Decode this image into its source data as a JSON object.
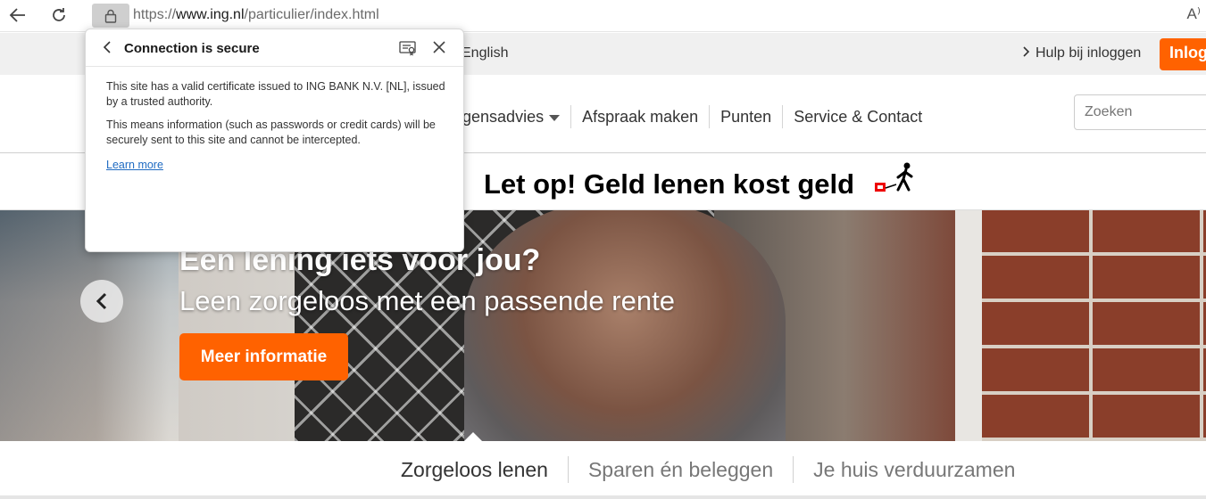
{
  "browser": {
    "url_prefix": "https://",
    "url_domain": "www.ing.nl",
    "url_path": "/particulier/index.html",
    "read_aloud": "A⁾"
  },
  "topbar": {
    "language": "English",
    "help": "Hulp bij inloggen",
    "login": "Inlog"
  },
  "nav": {
    "items": [
      "ogensadvies",
      "Afspraak maken",
      "Punten",
      "Service & Contact"
    ],
    "search_placeholder": "Zoeken"
  },
  "warning": {
    "text": "Let op! Geld lenen kost geld"
  },
  "hero": {
    "title": "Een lening iets voor jou?",
    "subtitle": "Leen zorgeloos met een passende rente",
    "cta": "Meer informatie"
  },
  "tabs": [
    "Zorgeloos lenen",
    "Sparen én beleggen",
    "Je huis verduurzamen"
  ],
  "popup": {
    "title": "Connection is secure",
    "paragraph1": "This site has a valid certificate issued to ING BANK N.V. [NL], issued by a trusted authority.",
    "paragraph2": "This means information (such as passwords or credit cards) will be securely sent to this site and cannot be intercepted.",
    "learn_more": "Learn more"
  },
  "colors": {
    "accent": "#ff6200",
    "link": "#1f6bc2"
  }
}
